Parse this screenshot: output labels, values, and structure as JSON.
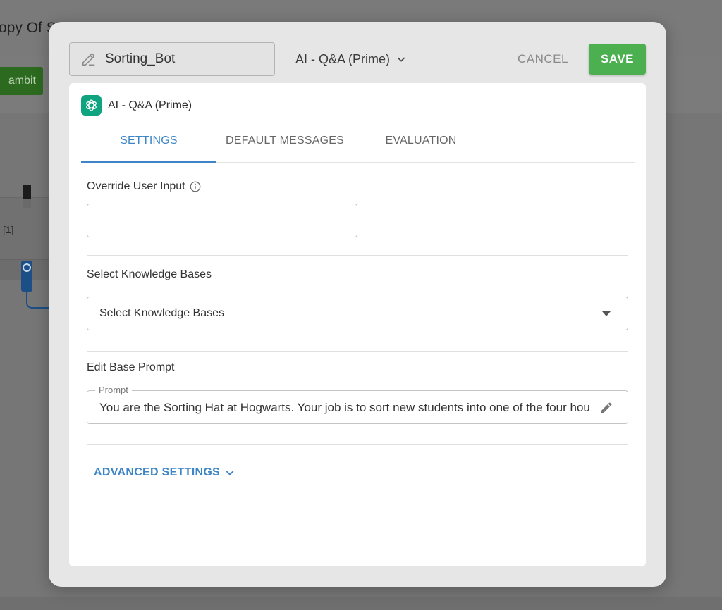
{
  "background": {
    "page_title": "opy Of S",
    "gambit_button": "ambit",
    "node_label": "[1]"
  },
  "modal": {
    "name_value": "Sorting_Bot",
    "model_select": "AI - Q&A (Prime)",
    "cancel_label": "CANCEL",
    "save_label": "SAVE",
    "panel": {
      "title": "AI - Q&A (Prime)",
      "tabs": [
        {
          "label": "SETTINGS",
          "active": true
        },
        {
          "label": "DEFAULT MESSAGES",
          "active": false
        },
        {
          "label": "EVALUATION",
          "active": false
        }
      ],
      "override_label": "Override User Input",
      "override_value": "",
      "kb_label": "Select Knowledge Bases",
      "kb_placeholder": "Select Knowledge Bases",
      "prompt_section_label": "Edit Base Prompt",
      "prompt_legend": "Prompt",
      "prompt_value": "You are the Sorting Hat at Hogwarts. Your job is to sort new students into one of the four houses",
      "advanced_label": "ADVANCED SETTINGS"
    }
  },
  "colors": {
    "accent": "#3d85c6",
    "save": "#4caf50",
    "ai_logo": "#10a37f"
  },
  "icons": [
    "pencil-icon",
    "chevron-down-icon",
    "openai-logo-icon",
    "info-icon",
    "dropdown-arrow-icon",
    "edit-icon"
  ]
}
